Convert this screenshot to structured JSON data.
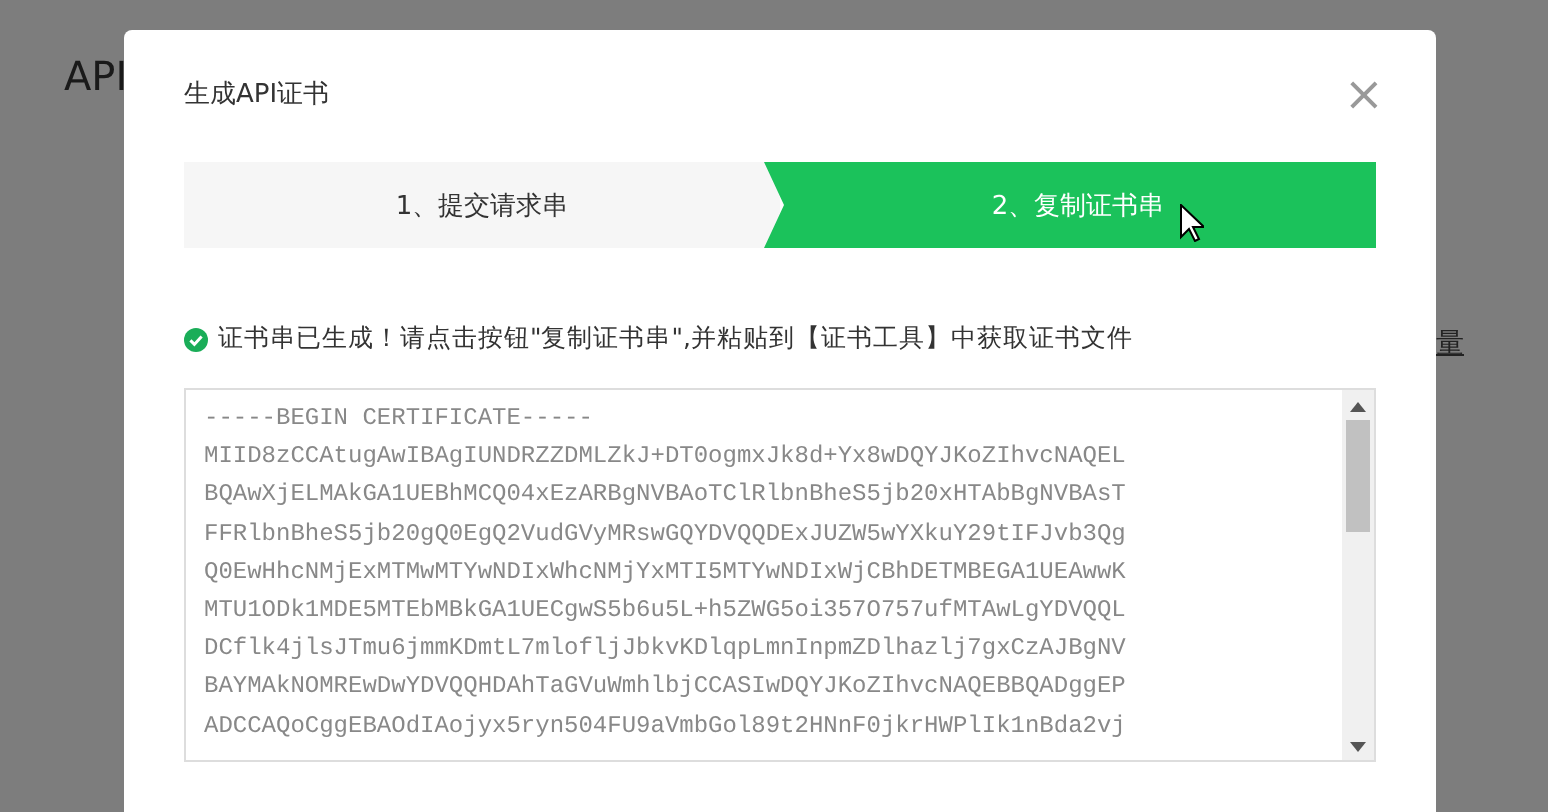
{
  "background_page": {
    "title": "API",
    "link_fragment": "量"
  },
  "dialog": {
    "title": "生成API证书",
    "close": "×",
    "steps": [
      {
        "label": "1、提交请求串",
        "selected": false
      },
      {
        "label": "2、复制证书串",
        "selected": true
      }
    ],
    "message": "证书串已生成！请点击按钮\"复制证书串\",并粘贴到【证书工具】中获取证书文件",
    "certificate_lines": [
      "-----BEGIN CERTIFICATE-----",
      "MIID8zCCAtugAwIBAgIUNDRZZDMLZkJ+DT0ogmxJk8d+Yx8wDQYJKoZIhvcNAQEL",
      "BQAwXjELMAkGA1UEBhMCQ04xEzARBgNVBAoTClRlbnBheS5jb20xHTAbBgNVBAsT",
      "FFRlbnBheS5jb20gQ0EgQ2VudGVyMRswGQYDVQQDExJUZW5wYXkuY29tIFJvb3Qg",
      "Q0EwHhcNMjExMTMwMTYwNDIxWhcNMjYxMTI5MTYwNDIxWjCBhDETMBEGA1UEAwwK",
      "MTU1ODk1MDE5MTEbMBkGA1UECgwS5b6u5L+h5ZWG5oi357O757ufMTAwLgYDVQQL",
      "DCflk4jlsJTmu6jmmKDmtL7mlofljJbkvKDlqpLmnInpmZDlhazlj7gxCzAJBgNV",
      "BAYMAkNOMREwDwYDVQQHDAhTaGVuWmhlbjCCASIwDQYJKoZIhvcNAQEBBQADggEP",
      "ADCCAQoCggEBAOdIAojyx5ryn504FU9aVmbGol89t2HNnF0jkrHWPlIk1nBda2vj"
    ]
  }
}
